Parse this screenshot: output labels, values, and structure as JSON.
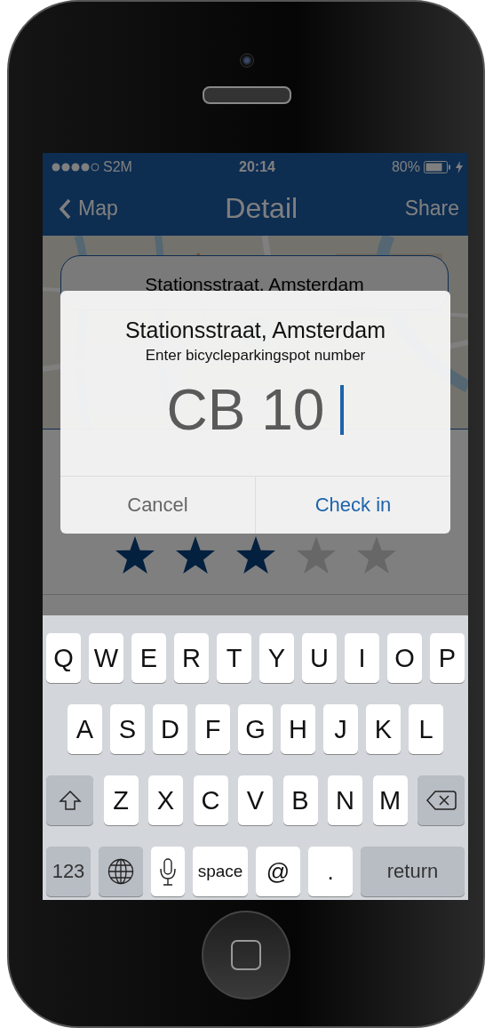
{
  "status_bar": {
    "carrier": "S2M",
    "time": "20:14",
    "battery": "80%"
  },
  "nav_bar": {
    "back": "Map",
    "title": "Detail",
    "action": "Share"
  },
  "location_card": {
    "title": "Stationsstraat, Amsterdam"
  },
  "rating": {
    "stars": 3
  },
  "dialog": {
    "title": "Stationsstraat, Amsterdam",
    "message": "Enter bicycleparkingspot number",
    "field": {
      "value": "CB 10"
    },
    "buttons": [
      {
        "label": "Cancel",
        "kind": "cancel"
      },
      {
        "label": "Check in",
        "kind": "primary"
      }
    ]
  },
  "keyboard": {
    "rows": [
      {
        "keys": [
          {
            "kind": "letter",
            "label": "Q"
          },
          {
            "kind": "letter",
            "label": "W"
          },
          {
            "kind": "letter",
            "label": "E"
          },
          {
            "kind": "letter",
            "label": "R"
          },
          {
            "kind": "letter",
            "label": "T"
          },
          {
            "kind": "letter",
            "label": "Y"
          },
          {
            "kind": "letter",
            "label": "U"
          },
          {
            "kind": "letter",
            "label": "I"
          },
          {
            "kind": "letter",
            "label": "O"
          },
          {
            "kind": "letter",
            "label": "P"
          }
        ]
      },
      {
        "keys": [
          {
            "kind": "letter",
            "label": "A"
          },
          {
            "kind": "letter",
            "label": "S"
          },
          {
            "kind": "letter",
            "label": "D"
          },
          {
            "kind": "letter",
            "label": "F"
          },
          {
            "kind": "letter",
            "label": "G"
          },
          {
            "kind": "letter",
            "label": "H"
          },
          {
            "kind": "letter",
            "label": "J"
          },
          {
            "kind": "letter",
            "label": "K"
          },
          {
            "kind": "letter",
            "label": "L"
          }
        ]
      },
      {
        "keys": [
          {
            "kind": "shift"
          },
          {
            "kind": "letter",
            "label": "Z"
          },
          {
            "kind": "letter",
            "label": "X"
          },
          {
            "kind": "letter",
            "label": "C"
          },
          {
            "kind": "letter",
            "label": "V"
          },
          {
            "kind": "letter",
            "label": "B"
          },
          {
            "kind": "letter",
            "label": "N"
          },
          {
            "kind": "letter",
            "label": "M"
          },
          {
            "kind": "delete"
          }
        ]
      },
      {
        "keys": [
          {
            "kind": "numbers",
            "label": "123"
          },
          {
            "kind": "globe"
          },
          {
            "kind": "mic"
          },
          {
            "kind": "space",
            "label": "space"
          },
          {
            "kind": "symbol",
            "label": "@"
          },
          {
            "kind": "symbol",
            "label": "."
          },
          {
            "kind": "return",
            "label": "return"
          }
        ]
      }
    ]
  }
}
